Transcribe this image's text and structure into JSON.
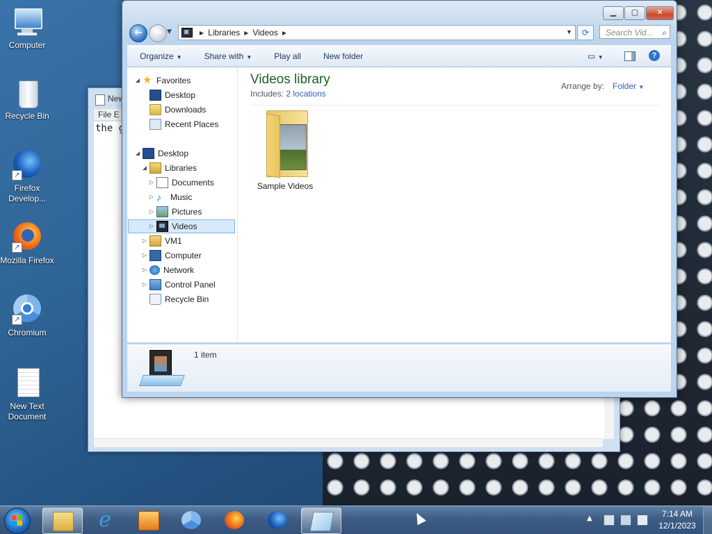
{
  "desktop_icons": [
    {
      "label": "Computer",
      "icon": "computer-icon"
    },
    {
      "label": "Recycle Bin",
      "icon": "recycle-bin-icon"
    },
    {
      "label": "Firefox Develop...",
      "icon": "firefox-developer-icon"
    },
    {
      "label": "Mozilla Firefox",
      "icon": "firefox-icon"
    },
    {
      "label": "Chromium",
      "icon": "chromium-icon"
    },
    {
      "label": "New Text Document",
      "icon": "text-document-icon"
    }
  ],
  "notepad": {
    "title": "New",
    "menu": "File E",
    "text": "the g"
  },
  "explorer": {
    "breadcrumb": [
      "Libraries",
      "Videos"
    ],
    "search_placeholder": "Search Vid...",
    "toolbar": {
      "organize": "Organize",
      "share_with": "Share with",
      "play_all": "Play all",
      "new_folder": "New folder"
    },
    "nav_tree": [
      {
        "label": "Favorites",
        "icon": "star-icon"
      },
      {
        "label": "Desktop",
        "icon": "desktop-icon"
      },
      {
        "label": "Downloads",
        "icon": "downloads-icon"
      },
      {
        "label": "Recent Places",
        "icon": "recent-places-icon"
      },
      {
        "label": "Desktop",
        "icon": "desktop-icon"
      },
      {
        "label": "Libraries",
        "icon": "libraries-icon"
      },
      {
        "label": "Documents",
        "icon": "documents-icon"
      },
      {
        "label": "Music",
        "icon": "music-icon"
      },
      {
        "label": "Pictures",
        "icon": "pictures-icon"
      },
      {
        "label": "Videos",
        "icon": "videos-icon",
        "selected": true
      },
      {
        "label": "VM1",
        "icon": "user-folder-icon"
      },
      {
        "label": "Computer",
        "icon": "computer-icon"
      },
      {
        "label": "Network",
        "icon": "network-icon"
      },
      {
        "label": "Control Panel",
        "icon": "control-panel-icon"
      },
      {
        "label": "Recycle Bin",
        "icon": "recycle-bin-icon"
      }
    ],
    "library": {
      "title": "Videos library",
      "includes_label": "Includes:",
      "includes_link": "2 locations",
      "arrange_label": "Arrange by:",
      "arrange_value": "Folder"
    },
    "items": [
      {
        "label": "Sample Videos",
        "icon": "folder-icon"
      }
    ],
    "details": {
      "count": "1 item"
    }
  },
  "taskbar": {
    "apps": [
      "explorer",
      "internet-explorer",
      "media-player",
      "chromium",
      "firefox",
      "firefox-developer",
      "notepad"
    ],
    "clock_time": "7:14 AM",
    "clock_date": "12/1/2023"
  },
  "colors": {
    "library_title": "#1e5d2b",
    "link": "#2a62b7",
    "selection": "#d8e9fb"
  }
}
